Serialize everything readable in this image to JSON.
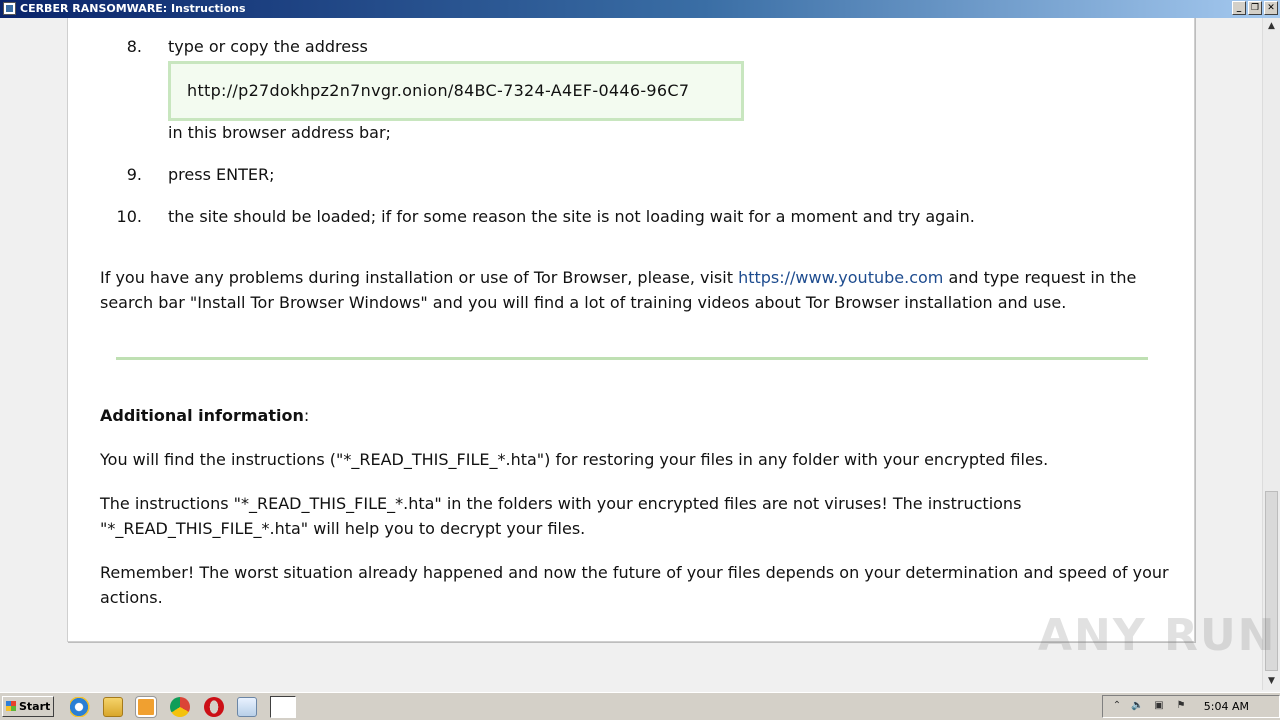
{
  "window": {
    "title": "CERBER RANSOMWARE: Instructions",
    "buttons": {
      "minimize": "_",
      "maximize": "❐",
      "close": "✕"
    }
  },
  "steps": [
    {
      "number": "8.",
      "text": "type or copy the address"
    },
    {
      "number": "9.",
      "text": "press ENTER;"
    },
    {
      "number": "10.",
      "text": "the site should be loaded; if for some reason the site is not loading wait for a moment and try again."
    }
  ],
  "address_box": {
    "url": "http://p27dokhpz2n7nvgr.onion/84BC-7324-A4EF-0446-96C7"
  },
  "after_address": "in this browser address bar;",
  "tor_help": {
    "before_link": "If you have any problems during installation or use of Tor Browser, please, visit ",
    "link": "https://www.youtube.com",
    "after_link": " and type request in the search bar \"Install Tor Browser Windows\" and you will find a lot of training videos about Tor Browser installation and use."
  },
  "additional": {
    "heading": "Additional information",
    "colon": ":",
    "p1": "You will find the instructions (\"*_READ_THIS_FILE_*.hta\") for restoring your files in any folder with your encrypted files.",
    "p2": "The instructions \"*_READ_THIS_FILE_*.hta\" in the folders with your encrypted files are not viruses! The instructions \"*_READ_THIS_FILE_*.hta\" will help you to decrypt your files.",
    "p3": "Remember! The worst situation already happened and now the future of your files depends on your determination and speed of your actions."
  },
  "watermark": "ANY RUN",
  "taskbar": {
    "start_label": "Start",
    "clock": "5:04 AM",
    "icons": [
      "internet-explorer-icon",
      "folder-icon",
      "media-player-icon",
      "chrome-icon",
      "opera-icon",
      "notepad-icon",
      "hta-window-icon"
    ],
    "tray_icons": [
      "show-hidden-icons-icon",
      "speaker-icon",
      "network-icon",
      "flag-icon"
    ]
  }
}
